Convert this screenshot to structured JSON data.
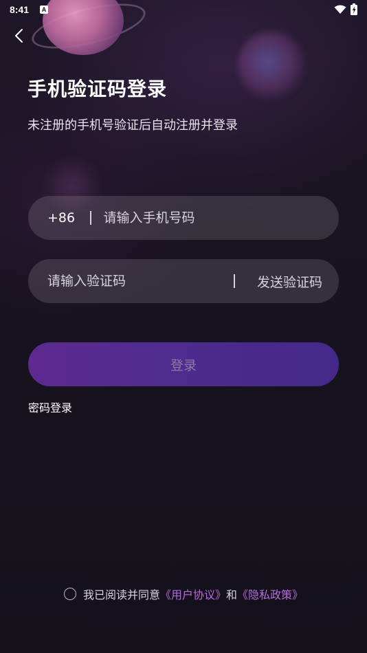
{
  "status_bar": {
    "time": "8:41",
    "notification_icon": "A"
  },
  "header": {
    "title": "手机验证码登录",
    "subtitle": "未注册的手机号验证后自动注册并登录"
  },
  "phone_field": {
    "country_code": "+86",
    "placeholder": "请输入手机号码",
    "value": ""
  },
  "code_field": {
    "placeholder": "请输入验证码",
    "value": "",
    "send_label": "发送验证码"
  },
  "login_button": {
    "label": "登录"
  },
  "password_login": {
    "label": "密码登录"
  },
  "agreement": {
    "prefix": "我已阅读并同意",
    "user_agreement": "《用户协议》",
    "conjunction": "和",
    "privacy_policy": "《隐私政策》",
    "checked": false
  },
  "colors": {
    "accent": "#b66ddc",
    "button_start": "#5d2a8f",
    "button_end": "#43288a"
  }
}
